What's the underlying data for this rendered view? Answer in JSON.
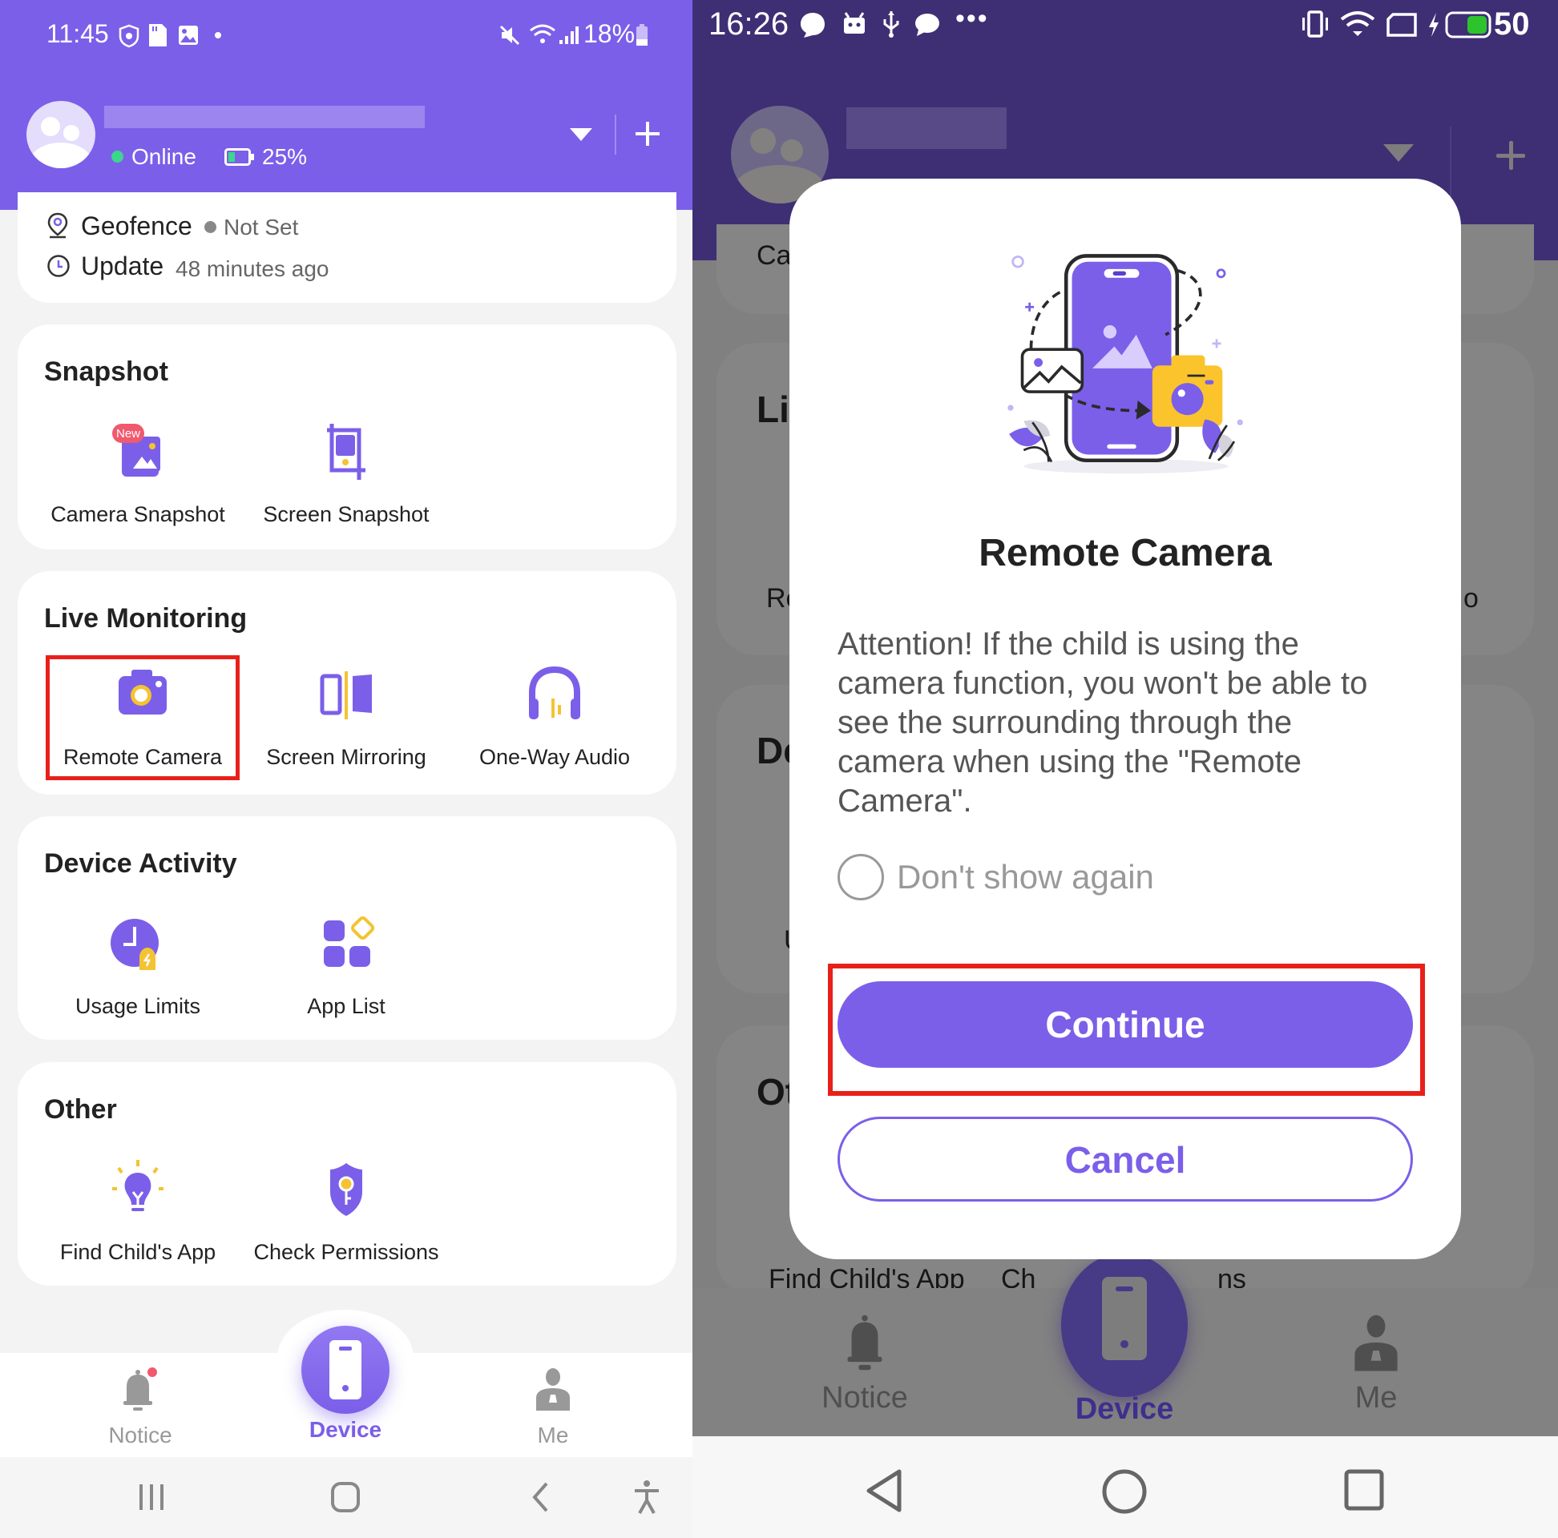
{
  "left": {
    "status_bar": {
      "time": "11:45",
      "battery": "18%"
    },
    "profile": {
      "name_blurred": true,
      "status": "Online",
      "battery": "25%",
      "status_color": "#3dd68c"
    },
    "info": {
      "geofence_label": "Geofence",
      "geofence_value": "Not Set",
      "update_label": "Update",
      "update_value": "48 minutes ago"
    },
    "sections": [
      {
        "title": "Snapshot",
        "items": [
          {
            "label": "Camera Snapshot",
            "icon": "camera-snapshot-icon",
            "badge": "New"
          },
          {
            "label": "Screen Snapshot",
            "icon": "screen-snapshot-icon"
          }
        ]
      },
      {
        "title": "Live Monitoring",
        "items": [
          {
            "label": "Remote Camera",
            "icon": "remote-camera-icon",
            "highlighted": true
          },
          {
            "label": "Screen Mirroring",
            "icon": "screen-mirroring-icon"
          },
          {
            "label": "One-Way Audio",
            "icon": "headphones-icon"
          }
        ]
      },
      {
        "title": "Device Activity",
        "items": [
          {
            "label": "Usage Limits",
            "icon": "usage-limits-icon"
          },
          {
            "label": "App List",
            "icon": "app-list-icon"
          }
        ]
      },
      {
        "title": "Other",
        "items": [
          {
            "label": "Find Child's App",
            "icon": "lightbulb-icon"
          },
          {
            "label": "Check Permissions",
            "icon": "shield-key-icon"
          }
        ]
      }
    ],
    "bottom_nav": [
      {
        "label": "Notice",
        "active": false
      },
      {
        "label": "Device",
        "active": true
      },
      {
        "label": "Me",
        "active": false
      }
    ]
  },
  "right": {
    "status_bar": {
      "time": "16:26",
      "battery": "50"
    },
    "background_peek": {
      "row1": "Ca",
      "live": "Li",
      "re": "Re",
      "o": "o",
      "de": "De",
      "u": "U",
      "ot": "Ot",
      "find": "Find Child's App",
      "ch": "Ch",
      "ns": "ns"
    },
    "modal": {
      "title": "Remote Camera",
      "body": "Attention! If the child is using the camera function, you won't be able to see the surrounding through the camera when using the \"Remote Camera\".",
      "checkbox_label": "Don't show again",
      "checkbox_checked": false,
      "continue_label": "Continue",
      "cancel_label": "Cancel"
    },
    "bottom_nav": [
      {
        "label": "Notice",
        "active": false
      },
      {
        "label": "Device",
        "active": true
      },
      {
        "label": "Me",
        "active": false
      }
    ]
  },
  "colors": {
    "accent": "#7b5fe9",
    "highlight_box": "#e8201a",
    "dark_header": "#3e2f74"
  }
}
